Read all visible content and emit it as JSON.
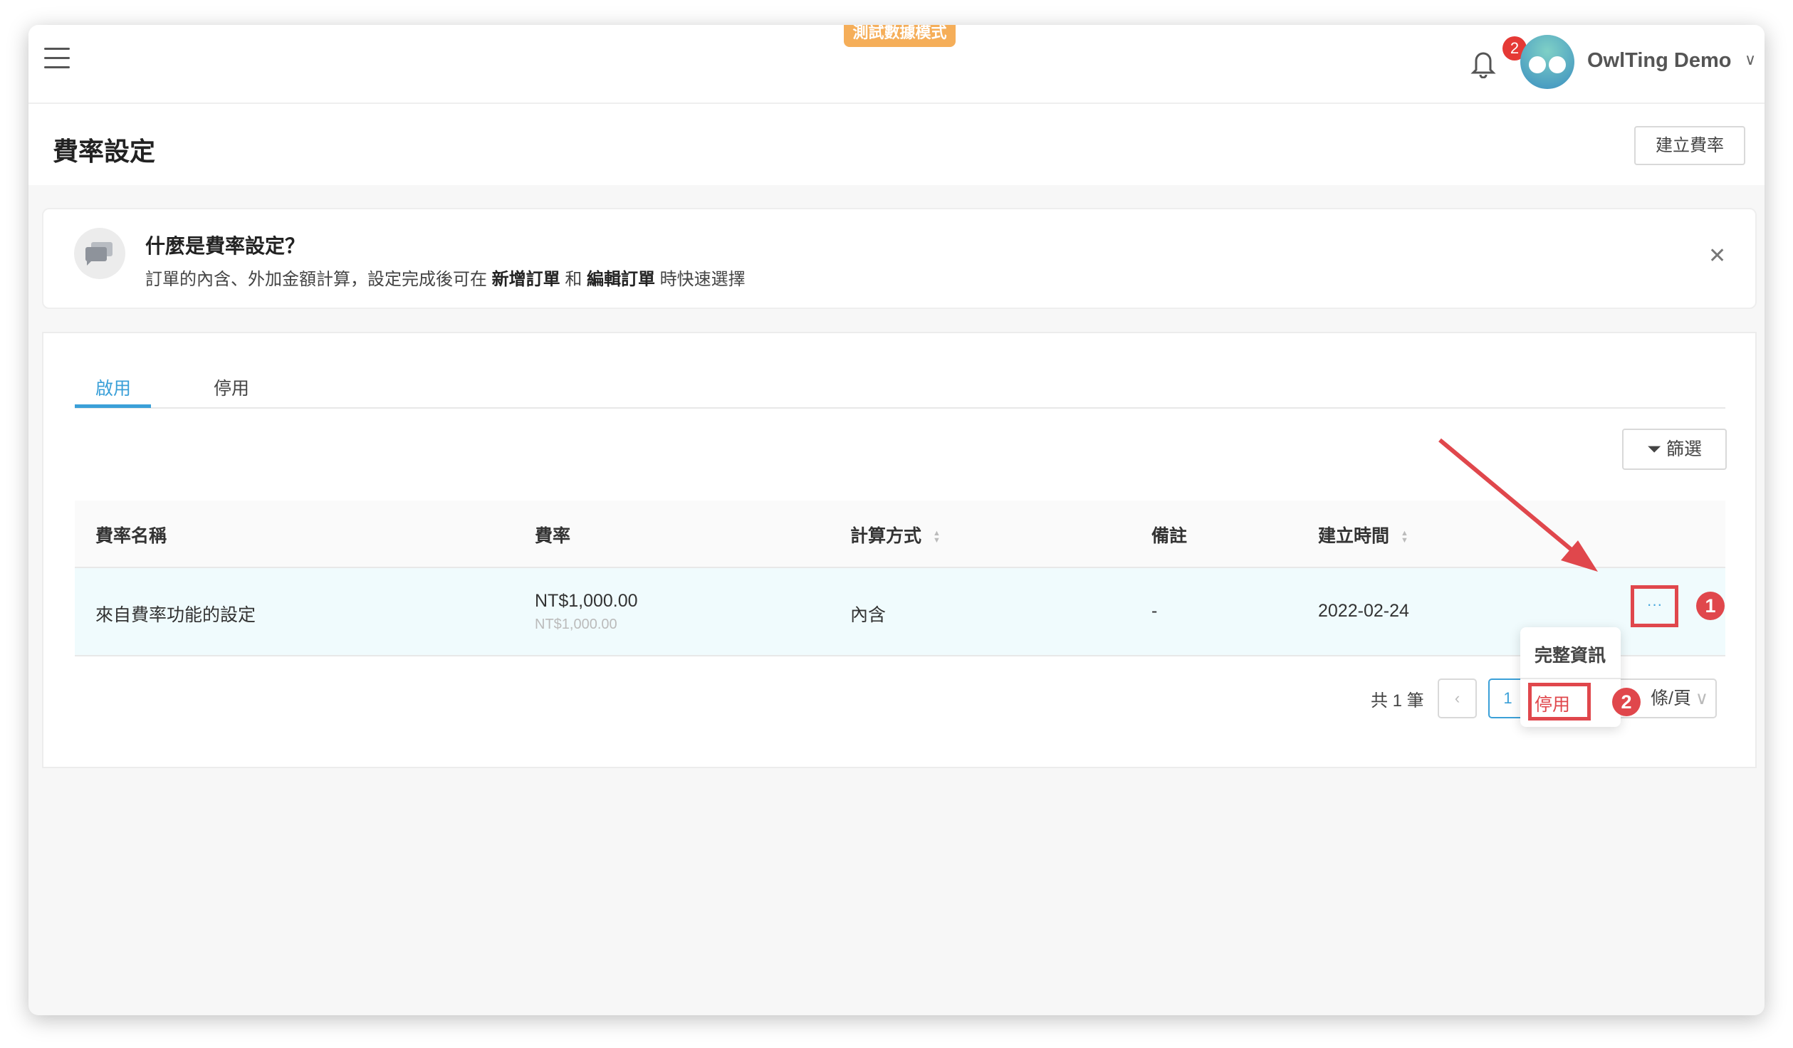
{
  "header": {
    "test_mode_badge": "測試數據模式",
    "notification_count": "2",
    "user_name": "OwlTing Demo"
  },
  "page": {
    "title": "費率設定",
    "create_button": "建立費率"
  },
  "info": {
    "title": "什麼是費率設定？",
    "desc_1": "訂單的內含、外加金額計算，設定完成後可在 ",
    "desc_bold_1": "新增訂單",
    "desc_2": " 和 ",
    "desc_bold_2": "編輯訂單",
    "desc_3": " 時快速選擇"
  },
  "tabs": [
    {
      "label": "啟用",
      "active": true
    },
    {
      "label": "停用",
      "active": false
    }
  ],
  "filter_button": "篩選",
  "table": {
    "columns": [
      "費率名稱",
      "費率",
      "計算方式",
      "備註",
      "建立時間"
    ],
    "rows": [
      {
        "name": "來自費率功能的設定",
        "rate": "NT$1,000.00",
        "rate_sub": "NT$1,000.00",
        "method": "內含",
        "note": "-",
        "created": "2022-02-24",
        "actions": "···"
      }
    ]
  },
  "pagination": {
    "total": "共 1 筆",
    "current_page": "1",
    "page_size": "條/頁"
  },
  "row_menu": {
    "items": [
      "完整資訊",
      "停用"
    ]
  },
  "annotations": {
    "step1": "1",
    "step2": "2",
    "color": "#e0474c"
  },
  "accent_color": "#3ba0d8"
}
